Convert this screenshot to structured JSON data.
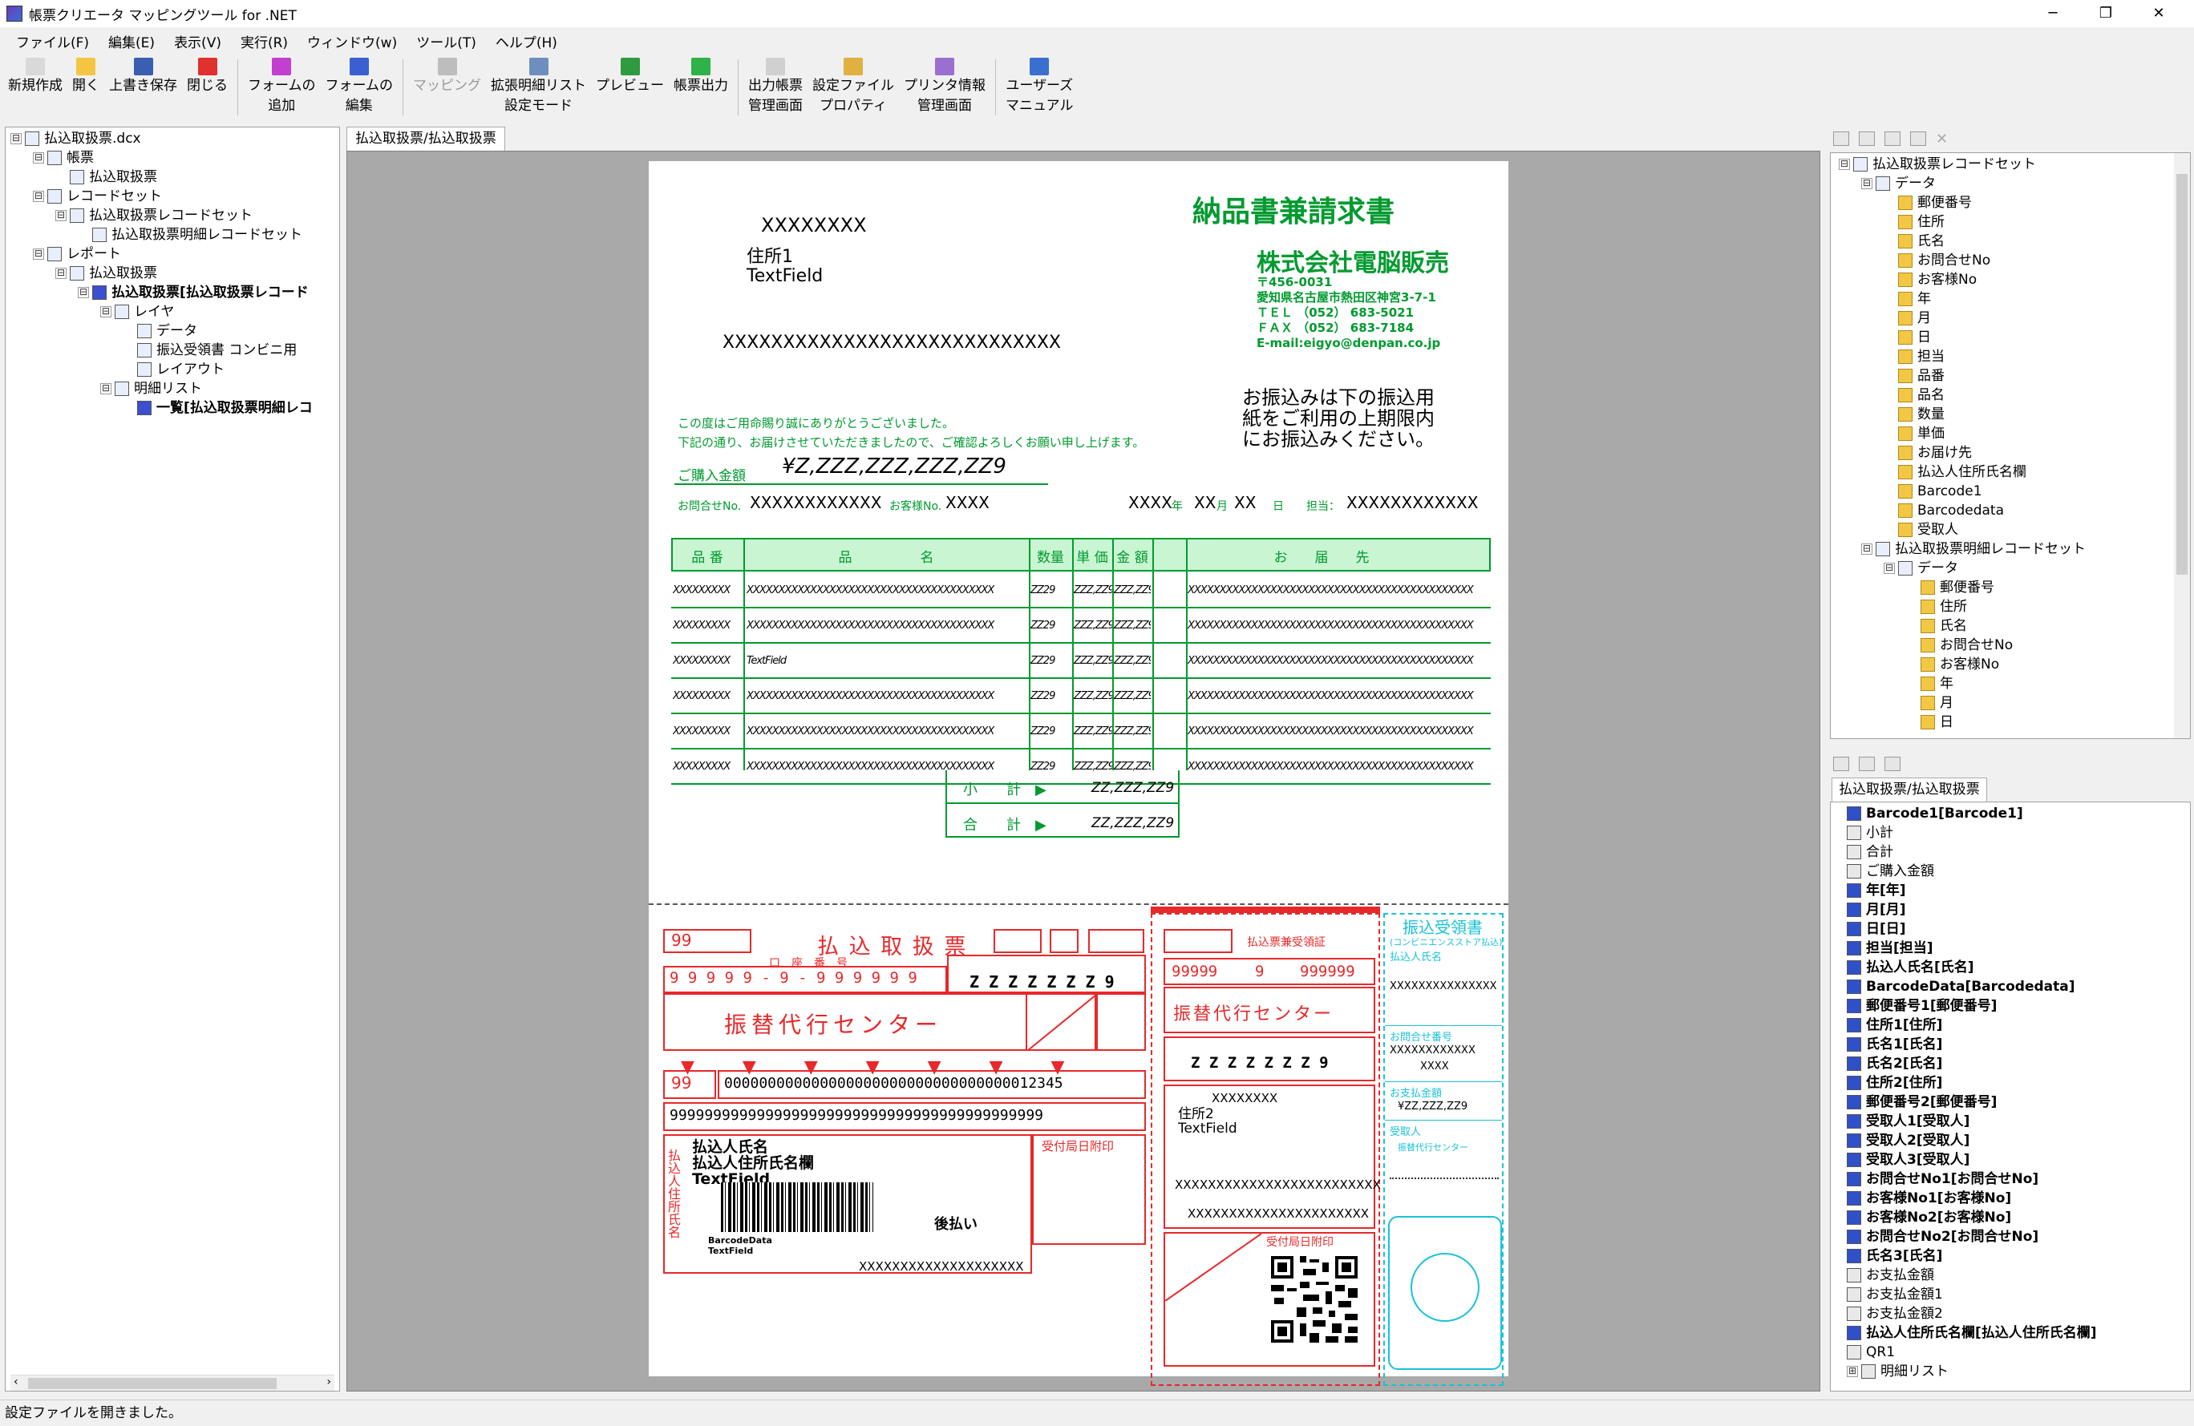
{
  "window": {
    "title": "帳票クリエータ マッピングツール for .NET",
    "min": "─",
    "restore": "❐",
    "close": "✕"
  },
  "menu": [
    "ファイル(F)",
    "編集(E)",
    "表示(V)",
    "実行(R)",
    "ウィンドウ(w)",
    "ツール(T)",
    "ヘルプ(H)"
  ],
  "toolbar": [
    {
      "l1": "新規作成",
      "l2": "",
      "icon": "new-file-icon",
      "color": "#d9d9d9"
    },
    {
      "l1": "開く",
      "l2": "",
      "icon": "open-folder-icon",
      "color": "#f5c542"
    },
    {
      "l1": "上書き保存",
      "l2": "",
      "icon": "save-icon",
      "color": "#3a5fb0"
    },
    {
      "l1": "閉じる",
      "l2": "",
      "icon": "close-icon",
      "color": "#e03030"
    },
    {
      "l1": "フォームの",
      "l2": "追加",
      "icon": "add-form-icon",
      "color": "#c23fd0"
    },
    {
      "l1": "フォームの",
      "l2": "編集",
      "icon": "edit-form-icon",
      "color": "#3a5fd0"
    },
    {
      "l1": "マッピング",
      "l2": "",
      "icon": "mapping-icon",
      "color": "#bdbdbd",
      "disabled": true
    },
    {
      "l1": "拡張明細リスト",
      "l2": "設定モード",
      "icon": "detail-list-icon",
      "color": "#6d8fbf"
    },
    {
      "l1": "プレビュー",
      "l2": "",
      "icon": "preview-icon",
      "color": "#2f9a3f"
    },
    {
      "l1": "帳票出力",
      "l2": "",
      "icon": "output-icon",
      "color": "#2fb24a"
    },
    {
      "l1": "出力帳票",
      "l2": "管理画面",
      "icon": "output-manage-icon",
      "color": "#d0d0d0"
    },
    {
      "l1": "設定ファイル",
      "l2": "プロパティ",
      "icon": "settings-file-icon",
      "color": "#e0b040"
    },
    {
      "l1": "プリンタ情報",
      "l2": "管理画面",
      "icon": "printer-icon",
      "color": "#9a6fd0"
    },
    {
      "l1": "ユーザーズ",
      "l2": "マニュアル",
      "icon": "help-icon",
      "color": "#3a6fd0"
    }
  ],
  "left_tree": [
    {
      "d": 0,
      "t": "払込取扱票.dcx",
      "exp": "⊟"
    },
    {
      "d": 1,
      "t": "帳票",
      "exp": "⊟"
    },
    {
      "d": 2,
      "t": "払込取扱票",
      "exp": ""
    },
    {
      "d": 1,
      "t": "レコードセット",
      "exp": "⊟"
    },
    {
      "d": 2,
      "t": "払込取扱票レコードセット",
      "exp": "⊟"
    },
    {
      "d": 3,
      "t": "払込取扱票明細レコードセット",
      "exp": ""
    },
    {
      "d": 1,
      "t": "レポート",
      "exp": "⊟"
    },
    {
      "d": 2,
      "t": "払込取扱票",
      "exp": "⊟"
    },
    {
      "d": 3,
      "t": "払込取扱票[払込取扱票レコード",
      "exp": "⊟",
      "bold": true
    },
    {
      "d": 4,
      "t": "レイヤ",
      "exp": "⊟"
    },
    {
      "d": 5,
      "t": "データ",
      "exp": ""
    },
    {
      "d": 5,
      "t": "振込受領書 コンビニ用",
      "exp": ""
    },
    {
      "d": 5,
      "t": "レイアウト",
      "exp": ""
    },
    {
      "d": 4,
      "t": "明細リスト",
      "exp": "⊟"
    },
    {
      "d": 5,
      "t": "一覧[払込取扱票明細レコ",
      "exp": "",
      "bold": true
    }
  ],
  "design_tab": "払込取扱票/払込取扱票",
  "form": {
    "title": "納品書兼請求書",
    "code": "XXXXXXXX",
    "addr1": "住所1",
    "textfield": "TextField",
    "name_line": "XXXXXXXXXXXXXXXXXXXXXXXXXXXX",
    "company": "株式会社電脳販売",
    "company_info": [
      "〒456-0031",
      "愛知県名古屋市熱田区神宮3-7-1",
      "ＴＥＬ （052） 683-5021",
      "ＦＡＸ （052） 683-7184",
      "E-mail:eigyo@denpan.co.jp"
    ],
    "notice": [
      "お振込みは下の振込用",
      "紙をご利用の上期限内",
      "にお振込みください。"
    ],
    "thanks1": "この度はご用命賜り誠にありがとうございました。",
    "thanks2": "下記の通り、お届けさせていただきましたので、ご確認よろしくお願い申し上げます。",
    "amount_label": "ご購入金額",
    "amount": "¥Z,ZZZ,ZZZ,ZZZ,ZZ9",
    "inquiry_label": "お問合せNo.",
    "inquiry": "XXXXXXXXXXXX",
    "customer_label": "お客様No.",
    "customer": "XXXX",
    "year": "XXXX",
    "year_unit": "年",
    "month": "XX",
    "month_unit": "月",
    "day": "XX",
    "day_unit": "日",
    "staff_label": "担当：",
    "staff": "XXXXXXXXXXXX",
    "headers": [
      "品 番",
      "品　　　　　名",
      "数量",
      "単 価",
      "金 額",
      "お　　届　　先"
    ],
    "rows": [
      [
        "XXXXXXXXX",
        "XXXXXXXXXXXXXXXXXXXXXXXXXXXXXXXXXXXXXXX",
        "ZZ29",
        "ZZZ,ZZ9",
        "ZZZ,ZZ9",
        "XXXXXXXXXXXXXXXXXXXXXXXXXXXXXXXXXXXXXXXXXXXXX"
      ],
      [
        "XXXXXXXXX",
        "XXXXXXXXXXXXXXXXXXXXXXXXXXXXXXXXXXXXXXX",
        "ZZ29",
        "ZZZ,ZZ9",
        "ZZZ,ZZ9",
        "XXXXXXXXXXXXXXXXXXXXXXXXXXXXXXXXXXXXXXXXXXXXX"
      ],
      [
        "XXXXXXXXX",
        "TextField",
        "ZZ29",
        "ZZZ,ZZ9",
        "ZZZ,ZZ9",
        "XXXXXXXXXXXXXXXXXXXXXXXXXXXXXXXXXXXXXXXXXXXXX"
      ],
      [
        "XXXXXXXXX",
        "XXXXXXXXXXXXXXXXXXXXXXXXXXXXXXXXXXXXXXX",
        "ZZ29",
        "ZZZ,ZZ9",
        "ZZZ,ZZ9",
        "XXXXXXXXXXXXXXXXXXXXXXXXXXXXXXXXXXXXXXXXXXXXX"
      ],
      [
        "XXXXXXXXX",
        "XXXXXXXXXXXXXXXXXXXXXXXXXXXXXXXXXXXXXXX",
        "ZZ29",
        "ZZZ,ZZ9",
        "ZZZ,ZZ9",
        "XXXXXXXXXXXXXXXXXXXXXXXXXXXXXXXXXXXXXXXXXXXXX"
      ],
      [
        "XXXXXXXXX",
        "XXXXXXXXXXXXXXXXXXXXXXXXXXXXXXXXXXXXXXX",
        "ZZ29",
        "ZZZ,ZZ9",
        "ZZZ,ZZ9",
        "XXXXXXXXXXXXXXXXXXXXXXXXXXXXXXXXXXXXXXXXXXXXX"
      ]
    ],
    "subtotal_label": "小　　計　▶",
    "subtotal": "ZZ,ZZZ,ZZ9",
    "total_label": "合　　計　▶",
    "total": "ZZ,ZZZ,ZZ9",
    "slip": {
      "nn": "99",
      "title": "払 込 取 扱 票",
      "acct_label": "口　座　番　号",
      "acct": "9 9 9 9 9 - 9 - 9 9 9 9 9 9",
      "amount_digits": "Z Z Z Z Z Z Z 9",
      "center": "振替代行センター",
      "code99": "99",
      "ocr1": "000000000000000000000000000000000012345",
      "ocr2": "9999999999999999999999999999999999999999999",
      "payer_label": "払込人氏名",
      "payer_field": "払込人住所氏名欄",
      "textfield": "TextField",
      "barcode_label": "BarcodeData",
      "barcode_tf": "TextField",
      "postpay": "後払い",
      "xline": "XXXXXXXXXXXXXXXXXXXX",
      "stamp": "受付局日附印",
      "side_label": "払込人住所氏名",
      "receipt_title": "払込票兼受領証",
      "r_acct1": "99999",
      "r_acct2": "9",
      "r_acct3": "999999",
      "r_center": "振替代行センター",
      "r_digits": "Z Z Z Z Z Z Z 9",
      "r_x": "XXXXXXXX",
      "r_addr": "住所2",
      "r_tf": "TextField",
      "r_x2": "XXXXXXXXXXXXXXXXXXXXXXXXX",
      "r_x3": "XXXXXXXXXXXXXXXXXXXXXX",
      "r_stamp": "受付局日附印",
      "c_title": "振込受領書",
      "c_sub": "(コンビニエンスストア払込)",
      "c_payer": "払込人氏名",
      "c_x1": "XXXXXXXXXXXXXXX",
      "c_inq": "お問合せ番号",
      "c_x2": "XXXXXXXXXXXX",
      "c_x3": "XXXX",
      "c_amt_label": "お支払金額",
      "c_amt": "¥ZZ,ZZZ,ZZ9",
      "c_to": "受取人",
      "c_center": "振替代行センター"
    }
  },
  "right_tree": [
    {
      "d": 0,
      "t": "払込取扱票レコードセット",
      "exp": "⊟"
    },
    {
      "d": 1,
      "t": "データ",
      "exp": "⊟"
    },
    {
      "d": 2,
      "t": "郵便番号"
    },
    {
      "d": 2,
      "t": "住所"
    },
    {
      "d": 2,
      "t": "氏名"
    },
    {
      "d": 2,
      "t": "お問合せNo"
    },
    {
      "d": 2,
      "t": "お客様No"
    },
    {
      "d": 2,
      "t": "年"
    },
    {
      "d": 2,
      "t": "月"
    },
    {
      "d": 2,
      "t": "日"
    },
    {
      "d": 2,
      "t": "担当"
    },
    {
      "d": 2,
      "t": "品番"
    },
    {
      "d": 2,
      "t": "品名"
    },
    {
      "d": 2,
      "t": "数量"
    },
    {
      "d": 2,
      "t": "単価"
    },
    {
      "d": 2,
      "t": "お届け先"
    },
    {
      "d": 2,
      "t": "払込人住所氏名欄"
    },
    {
      "d": 2,
      "t": "Barcode1"
    },
    {
      "d": 2,
      "t": "Barcodedata"
    },
    {
      "d": 2,
      "t": "受取人"
    },
    {
      "d": 1,
      "t": "払込取扱票明細レコードセット",
      "exp": "⊟"
    },
    {
      "d": 2,
      "t": "データ",
      "exp": "⊟"
    },
    {
      "d": 3,
      "t": "郵便番号"
    },
    {
      "d": 3,
      "t": "住所"
    },
    {
      "d": 3,
      "t": "氏名"
    },
    {
      "d": 3,
      "t": "お問合せNo"
    },
    {
      "d": 3,
      "t": "お客様No"
    },
    {
      "d": 3,
      "t": "年"
    },
    {
      "d": 3,
      "t": "月"
    },
    {
      "d": 3,
      "t": "日"
    }
  ],
  "right_tab": "払込取扱票/払込取扱票",
  "right_list": [
    {
      "t": "Barcode1[Barcode1]",
      "b": true
    },
    {
      "t": "小計"
    },
    {
      "t": "合計"
    },
    {
      "t": "ご購入金額"
    },
    {
      "t": "年[年]",
      "b": true
    },
    {
      "t": "月[月]",
      "b": true
    },
    {
      "t": "日[日]",
      "b": true
    },
    {
      "t": "担当[担当]",
      "b": true
    },
    {
      "t": "払込人氏名[氏名]",
      "b": true
    },
    {
      "t": "BarcodeData[Barcodedata]",
      "b": true
    },
    {
      "t": "郵便番号1[郵便番号]",
      "b": true
    },
    {
      "t": "住所1[住所]",
      "b": true
    },
    {
      "t": "氏名1[氏名]",
      "b": true
    },
    {
      "t": "氏名2[氏名]",
      "b": true
    },
    {
      "t": "住所2[住所]",
      "b": true
    },
    {
      "t": "郵便番号2[郵便番号]",
      "b": true
    },
    {
      "t": "受取人1[受取人]",
      "b": true
    },
    {
      "t": "受取人2[受取人]",
      "b": true
    },
    {
      "t": "受取人3[受取人]",
      "b": true
    },
    {
      "t": "お問合せNo1[お問合せNo]",
      "b": true
    },
    {
      "t": "お客様No1[お客様No]",
      "b": true
    },
    {
      "t": "お客様No2[お客様No]",
      "b": true
    },
    {
      "t": "お問合せNo2[お問合せNo]",
      "b": true
    },
    {
      "t": "氏名3[氏名]",
      "b": true
    },
    {
      "t": "お支払金額"
    },
    {
      "t": "お支払金額1"
    },
    {
      "t": "お支払金額2"
    },
    {
      "t": "払込人住所氏名欄[払込人住所氏名欄]",
      "b": true
    },
    {
      "t": "QR1"
    },
    {
      "t": "明細リスト",
      "exp": "⊞"
    }
  ],
  "status": "設定ファイルを開きました。"
}
